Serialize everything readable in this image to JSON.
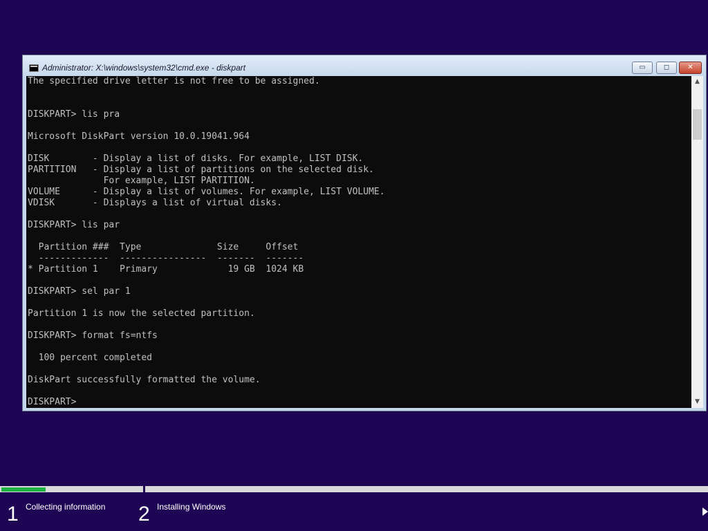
{
  "window": {
    "title": "Administrator: X:\\windows\\system32\\cmd.exe - diskpart",
    "minimize_glyph": "▭",
    "maximize_glyph": "◻",
    "close_glyph": "✕",
    "icon": "cmd-console-icon"
  },
  "console": {
    "lines": [
      "The specified drive letter is not free to be assigned.",
      "",
      "",
      "DISKPART> lis pra",
      "",
      "Microsoft DiskPart version 10.0.19041.964",
      "",
      "DISK        - Display a list of disks. For example, LIST DISK.",
      "PARTITION   - Display a list of partitions on the selected disk.",
      "              For example, LIST PARTITION.",
      "VOLUME      - Display a list of volumes. For example, LIST VOLUME.",
      "VDISK       - Displays a list of virtual disks.",
      "",
      "DISKPART> lis par",
      "",
      "  Partition ###  Type              Size     Offset",
      "  -------------  ----------------  -------  -------",
      "* Partition 1    Primary             19 GB  1024 KB",
      "",
      "DISKPART> sel par 1",
      "",
      "Partition 1 is now the selected partition.",
      "",
      "DISKPART> format fs=ntfs",
      "",
      "  100 percent completed",
      "",
      "DiskPart successfully formatted the volume.",
      "",
      "DISKPART>"
    ],
    "text_color": "#c0c0c0",
    "background": "#0c0c0c"
  },
  "scrollbar": {
    "up_glyph": "▲",
    "down_glyph": "▼"
  },
  "setup": {
    "progress_fraction": 0.31,
    "progress_color": "#1db343",
    "steps": [
      {
        "number": "1",
        "label": "Collecting information"
      },
      {
        "number": "2",
        "label": "Installing Windows"
      }
    ]
  },
  "colors": {
    "desktop": "#1e0655"
  }
}
